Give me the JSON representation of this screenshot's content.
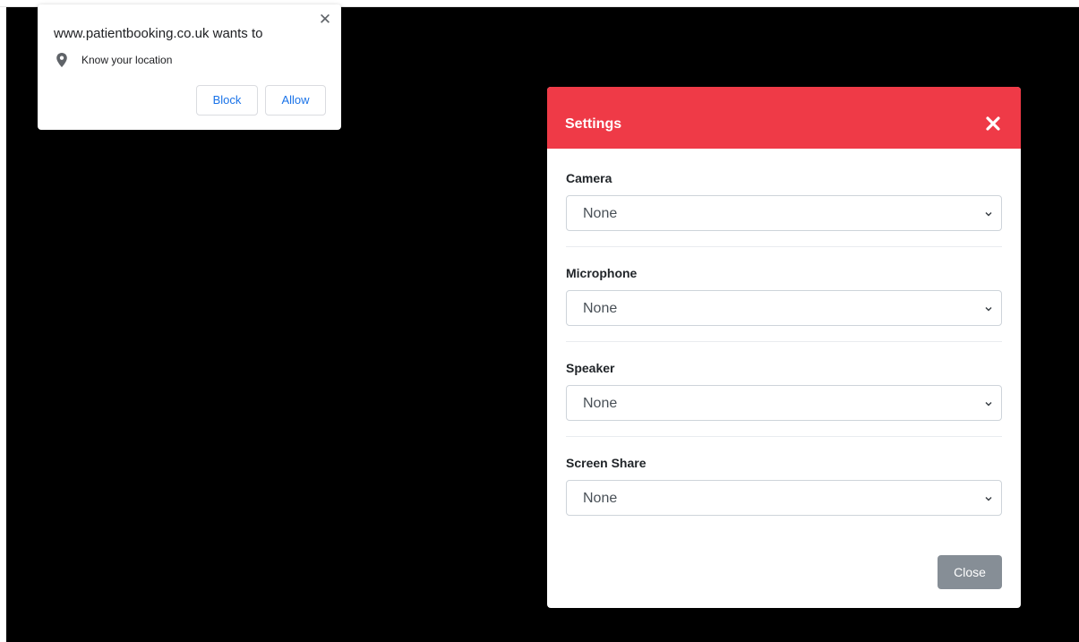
{
  "permission_prompt": {
    "title": "www.patientbooking.co.uk wants to",
    "request": "Know your location",
    "block_label": "Block",
    "allow_label": "Allow",
    "icons": {
      "close": "close-icon",
      "location": "location-pin-icon"
    },
    "button_text_color": "#1a73e8"
  },
  "settings_modal": {
    "title": "Settings",
    "header_color": "#ef3a47",
    "fields": [
      {
        "label": "Camera",
        "value": "None"
      },
      {
        "label": "Microphone",
        "value": "None"
      },
      {
        "label": "Speaker",
        "value": "None"
      },
      {
        "label": "Screen Share",
        "value": "None"
      }
    ],
    "close_label": "Close",
    "close_button_color": "#868e96",
    "icons": {
      "dismiss": "close-x-icon",
      "dropdown": "chevron-down-icon"
    }
  }
}
